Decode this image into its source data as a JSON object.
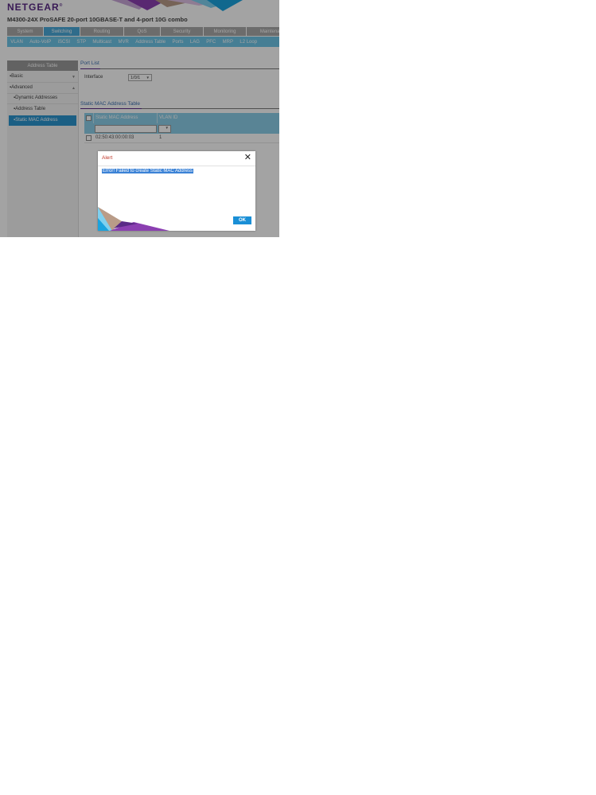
{
  "header": {
    "logo_text": "NETGEAR",
    "logo_mark": "®",
    "product_title": "M4300-24X ProSAFE 20-port 10GBASE-T and 4-port 10G combo"
  },
  "main_tabs": [
    "System",
    "Switching",
    "Routing",
    "QoS",
    "Security",
    "Monitoring",
    "Maintenance"
  ],
  "sub_tabs": [
    "VLAN",
    "Auto-VoIP",
    "iSCSI",
    "STP",
    "Multicast",
    "MVR",
    "Address Table",
    "Ports",
    "LAG",
    "PFC",
    "MRP",
    "L2 Loop"
  ],
  "sidebar": {
    "heading": "Address Table",
    "items": [
      {
        "label": "Basic"
      },
      {
        "label": "Advanced"
      },
      {
        "label": "Dynamic Addresses"
      },
      {
        "label": "Address Table"
      },
      {
        "label": "Static MAC Address"
      }
    ]
  },
  "port_list": {
    "title": "Port List",
    "interface_label": "Interface",
    "interface_value": "1/0/1"
  },
  "static_mac_table": {
    "title": "Static MAC Address Table",
    "columns": [
      "Static MAC Address",
      "VLAN ID"
    ],
    "rows": [
      {
        "mac": "02:50:43:00:00:03",
        "vlan": "1"
      }
    ]
  },
  "alert": {
    "title": "Alert",
    "message": "Error! Failed to create Static MAC Address",
    "ok_label": "OK"
  },
  "colors": {
    "brand": "#5a2a86",
    "active_tab": "#4aaad9",
    "subnav": "#6ec6e8",
    "active_sidebar": "#2b95cf",
    "alert_title": "#c0392b",
    "ok_button": "#1a8fd6"
  }
}
